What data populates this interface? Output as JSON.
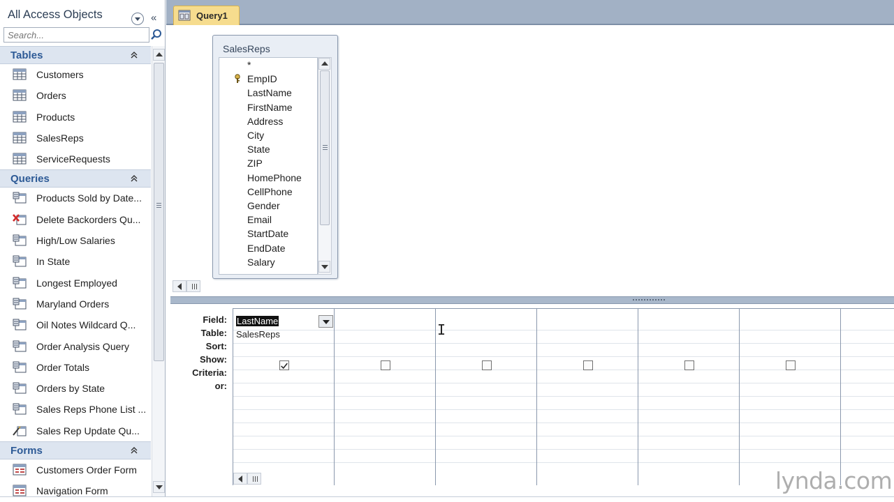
{
  "nav": {
    "title": "All Access Objects",
    "search_placeholder": "Search...",
    "groups": {
      "tables": {
        "label": "Tables",
        "items": [
          "Customers",
          "Orders",
          "Products",
          "SalesReps",
          "ServiceRequests"
        ]
      },
      "queries": {
        "label": "Queries",
        "items": [
          {
            "label": "Products Sold by Date...",
            "icon": "select-query-icon"
          },
          {
            "label": "Delete Backorders Qu...",
            "icon": "delete-query-icon"
          },
          {
            "label": "High/Low Salaries",
            "icon": "select-query-icon"
          },
          {
            "label": "In State",
            "icon": "select-query-icon"
          },
          {
            "label": "Longest Employed",
            "icon": "select-query-icon"
          },
          {
            "label": "Maryland Orders",
            "icon": "select-query-icon"
          },
          {
            "label": "Oil Notes Wildcard Q...",
            "icon": "select-query-icon"
          },
          {
            "label": "Order Analysis Query",
            "icon": "select-query-icon"
          },
          {
            "label": "Order Totals",
            "icon": "select-query-icon"
          },
          {
            "label": "Orders by State",
            "icon": "select-query-icon"
          },
          {
            "label": "Sales Reps Phone List ...",
            "icon": "select-query-icon"
          },
          {
            "label": "Sales Rep Update Qu...",
            "icon": "update-query-icon"
          }
        ]
      },
      "forms": {
        "label": "Forms",
        "items": [
          "Customers Order Form",
          "Navigation Form"
        ]
      }
    }
  },
  "tabs": [
    {
      "label": "Query1",
      "active": true
    }
  ],
  "table_box": {
    "title": "SalesReps",
    "fields": [
      "*",
      "EmpID",
      "LastName",
      "FirstName",
      "Address",
      "City",
      "State",
      "ZIP",
      "HomePhone",
      "CellPhone",
      "Gender",
      "Email",
      "StartDate",
      "EndDate",
      "Salary"
    ],
    "primary_key": "EmpID"
  },
  "grid": {
    "row_labels": {
      "field": "Field:",
      "table": "Table:",
      "sort": "Sort:",
      "show": "Show:",
      "criteria": "Criteria:",
      "or": "or:"
    },
    "columns": [
      {
        "field": "LastName",
        "table": "SalesReps",
        "show": true
      },
      {
        "field": "",
        "table": "",
        "show": false
      },
      {
        "field": "",
        "table": "",
        "show": false
      },
      {
        "field": "",
        "table": "",
        "show": false
      },
      {
        "field": "",
        "table": "",
        "show": false
      },
      {
        "field": "",
        "table": "",
        "show": false
      }
    ]
  },
  "watermark": "lynda.com",
  "colors": {
    "group_header": "#dde5f0",
    "group_label": "#2d5a96",
    "tab_active": "#f6dc8e",
    "tabstrip": "#a2b1c5"
  }
}
